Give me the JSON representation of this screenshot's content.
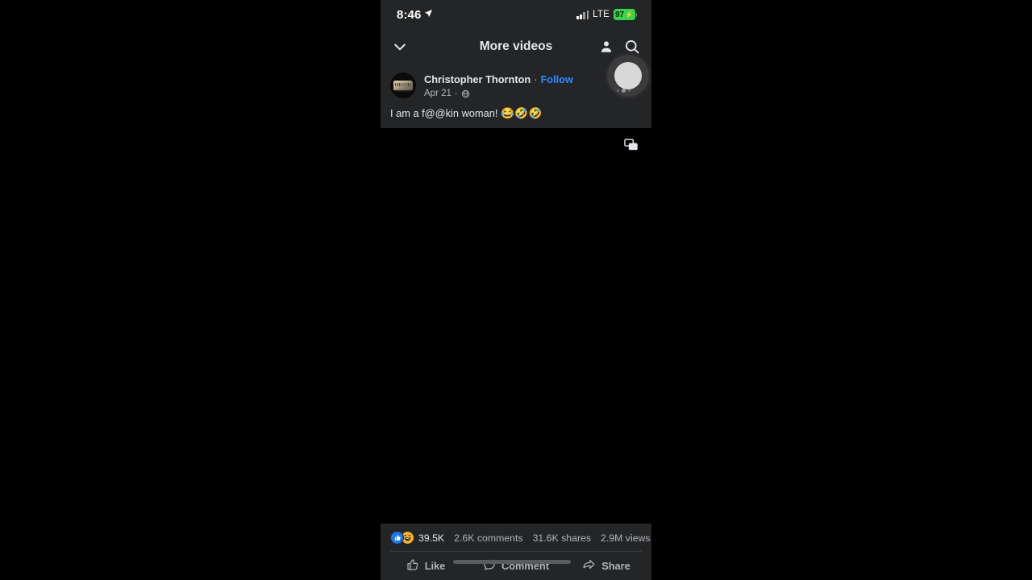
{
  "status_bar": {
    "time": "8:46",
    "location_icon": "location-arrow-icon",
    "signal_icon": "cellular-signal-icon",
    "network": "LTE",
    "battery_percent": "97",
    "battery_charging_icon": "charging-bolt-icon",
    "battery_color": "#32d74b"
  },
  "nav": {
    "back_icon": "chevron-down-icon",
    "title": "More videos",
    "profile_icon": "person-icon",
    "search_icon": "search-icon"
  },
  "post": {
    "avatar": "author-avatar",
    "author": "Christopher Thornton",
    "separator": "·",
    "follow_label": "Follow",
    "date": "Apr 21",
    "privacy_icon": "globe-icon",
    "text": "I am a f@@kin woman!",
    "emojis": "😂🤣🤣",
    "follow_color": "#2e89ff"
  },
  "video": {
    "pip_icon": "picture-in-picture-icon",
    "background_color": "#000000"
  },
  "recorder": {
    "bubble_icon": "screen-record-bubble",
    "dots_icon": "drag-handle-dots"
  },
  "engagement": {
    "reaction_like_icon": "thumbs-up-reaction-icon",
    "reaction_haha_icon": "haha-reaction-icon",
    "reaction_count": "39.5K",
    "comments": "2.6K comments",
    "shares": "31.6K shares",
    "views": "2.9M views"
  },
  "actions": {
    "like_icon": "thumbs-up-icon",
    "like_label": "Like",
    "comment_icon": "comment-bubble-icon",
    "comment_label": "Comment",
    "share_icon": "share-arrow-icon",
    "share_label": "Share",
    "scrubber": "video-progress-bar"
  }
}
